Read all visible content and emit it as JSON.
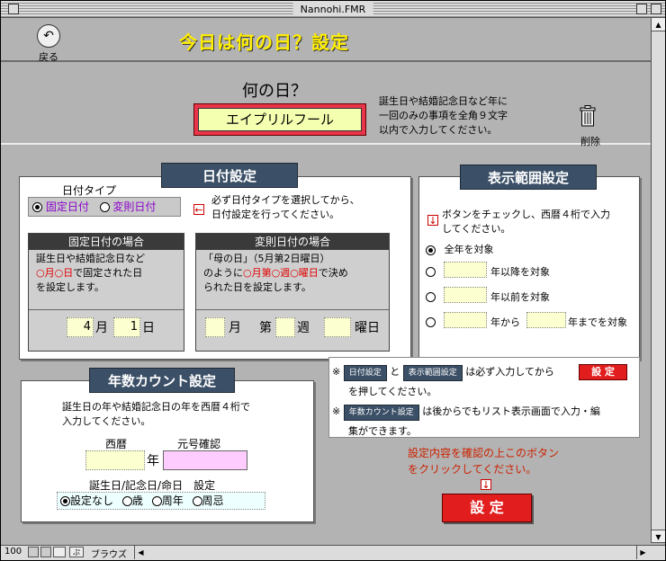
{
  "window": {
    "title": "Nannohi.FMR"
  },
  "header": {
    "back_label": "戻る",
    "title": "今日は何の日？設定"
  },
  "top": {
    "heading": "何の日？",
    "anniversary_value": "エイプリルフール",
    "note": [
      "誕生日や結婚記念日など年に",
      "一回のみの事項を全角９文字",
      "以内で入力してください。"
    ],
    "delete_label": "削除"
  },
  "date_settings": {
    "title": "日付設定",
    "type_label": "日付タイプ",
    "type_fixed": "固定日付",
    "type_variable": "変則日付",
    "instruction": [
      "必ず日付タイプを選択してから、",
      "日付設定を行ってください。"
    ],
    "fixed": {
      "header": "固定日付の場合",
      "desc_line1": "誕生日や結婚記念日など",
      "desc_line2_red": "○月○日",
      "desc_line2_rest": "で固定された日",
      "desc_line3": "を設定します。",
      "month_value": "4",
      "month_unit": "月",
      "day_value": "1",
      "day_unit": "日"
    },
    "variable": {
      "header": "変則日付の場合",
      "desc_line1": "「母の日」（5月第2日曜日）",
      "desc_line2_pre": "のように",
      "desc_line2_red": "○月第○週○曜日",
      "desc_line2_post": "で決め",
      "desc_line3": "られた日を設定します。",
      "month_unit": "月",
      "week_prefix": "第",
      "week_unit": "週",
      "weekday_unit": "曜日"
    }
  },
  "display_range": {
    "title": "表示範囲設定",
    "instruction": [
      "ボタンをチェックし、西暦４桁で入力",
      "してください。"
    ],
    "opt_all": "全年を対象",
    "opt_after": "年以降を対象",
    "opt_before": "年以前を対象",
    "opt_from": "年から",
    "opt_to": "年までを対象"
  },
  "year_count": {
    "title": "年数カウント設定",
    "instruction": [
      "誕生日の年や結婚記念日の年を西暦４桁で",
      "入力してください。"
    ],
    "label_year": "西暦",
    "label_era": "元号確認",
    "year_unit": "年",
    "option_label": "誕生日/記念日/命日　設定",
    "opt_none": "設定なし",
    "opt_age": "歳",
    "opt_anniv": "周年",
    "opt_memorial": "周忌"
  },
  "notes": {
    "mark": "※",
    "btn_date": "日付設定",
    "and": "と",
    "btn_range": "表示範囲設定",
    "must_text": "は必ず入力してから",
    "set_btn": "設 定",
    "line1b": "を押してください。",
    "btn_count": "年数カウント設定",
    "line2a": "は後からでもリスト表示画面で入力・編",
    "line2b": "集ができます。"
  },
  "confirm": {
    "line1": "設定内容を確認の上このボタン",
    "line2": "をクリックしてください。",
    "button": "設 定"
  },
  "status": {
    "zoom": "100",
    "mode": "ブラウズ"
  },
  "colors": {
    "accent_navy": "#3b4f66",
    "red_button": "#e21d1d",
    "title_yellow": "#ffee00"
  }
}
